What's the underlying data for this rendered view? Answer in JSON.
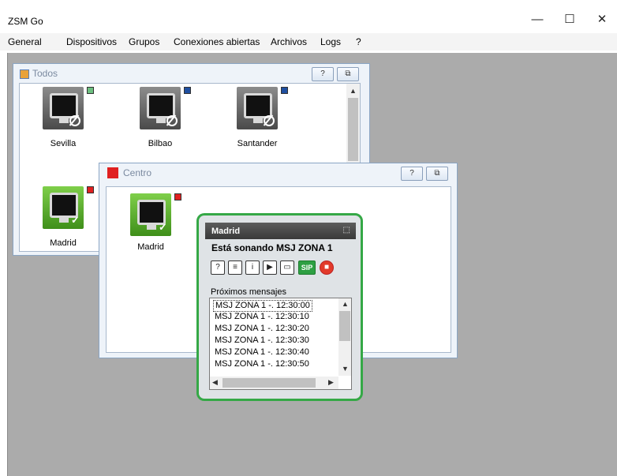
{
  "app": {
    "title": "ZSM Go"
  },
  "window_controls": {
    "minimize": "—",
    "maximize": "☐",
    "close": "✕"
  },
  "menu": [
    "General",
    "Dispositivos",
    "Grupos",
    "Conexiones abiertas",
    "Archivos",
    "Logs",
    "?"
  ],
  "windows": {
    "todos": {
      "title": "Todos",
      "help_btn": "?",
      "restore_btn": "⧉",
      "devices": [
        {
          "label": "Sevilla",
          "state": "offline",
          "status_color": "#6dbf80"
        },
        {
          "label": "Bilbao",
          "state": "offline",
          "status_color": "#1f4fa0"
        },
        {
          "label": "Santander",
          "state": "offline",
          "status_color": "#1f4fa0"
        },
        {
          "label": "Madrid",
          "state": "online",
          "status_color": "#e02020"
        }
      ]
    },
    "centro": {
      "title": "Centro",
      "title_icon_color": "#e02020",
      "help_btn": "?",
      "restore_btn": "⧉",
      "devices": [
        {
          "label": "Madrid",
          "state": "online",
          "status_color": "#e02020"
        }
      ]
    }
  },
  "popup": {
    "title": "Madrid",
    "restore_icon": "⬚",
    "status_text": "Está sonando MSJ ZONA 1",
    "toolbar": [
      {
        "name": "help",
        "glyph": "?"
      },
      {
        "name": "document",
        "glyph": "≡"
      },
      {
        "name": "info",
        "glyph": "i"
      },
      {
        "name": "play",
        "glyph": "▶"
      },
      {
        "name": "screen",
        "glyph": "▭"
      },
      {
        "name": "sip",
        "glyph": "SIP"
      },
      {
        "name": "stop",
        "glyph": "■"
      }
    ],
    "section_label": "Próximos mensajes",
    "messages": [
      "MSJ ZONA 1 -. 12:30:00",
      "MSJ ZONA 1 -. 12:30:10",
      "MSJ ZONA 1 -. 12:30:20",
      "MSJ ZONA 1 -. 12:30:30",
      "MSJ ZONA 1 -. 12:30:40",
      "MSJ ZONA 1 -. 12:30:50"
    ],
    "accent_color": "#35a846"
  },
  "colors": {
    "mdi_background": "#ababab",
    "online": "#4caf2a",
    "offline": "#5a5a5a"
  }
}
